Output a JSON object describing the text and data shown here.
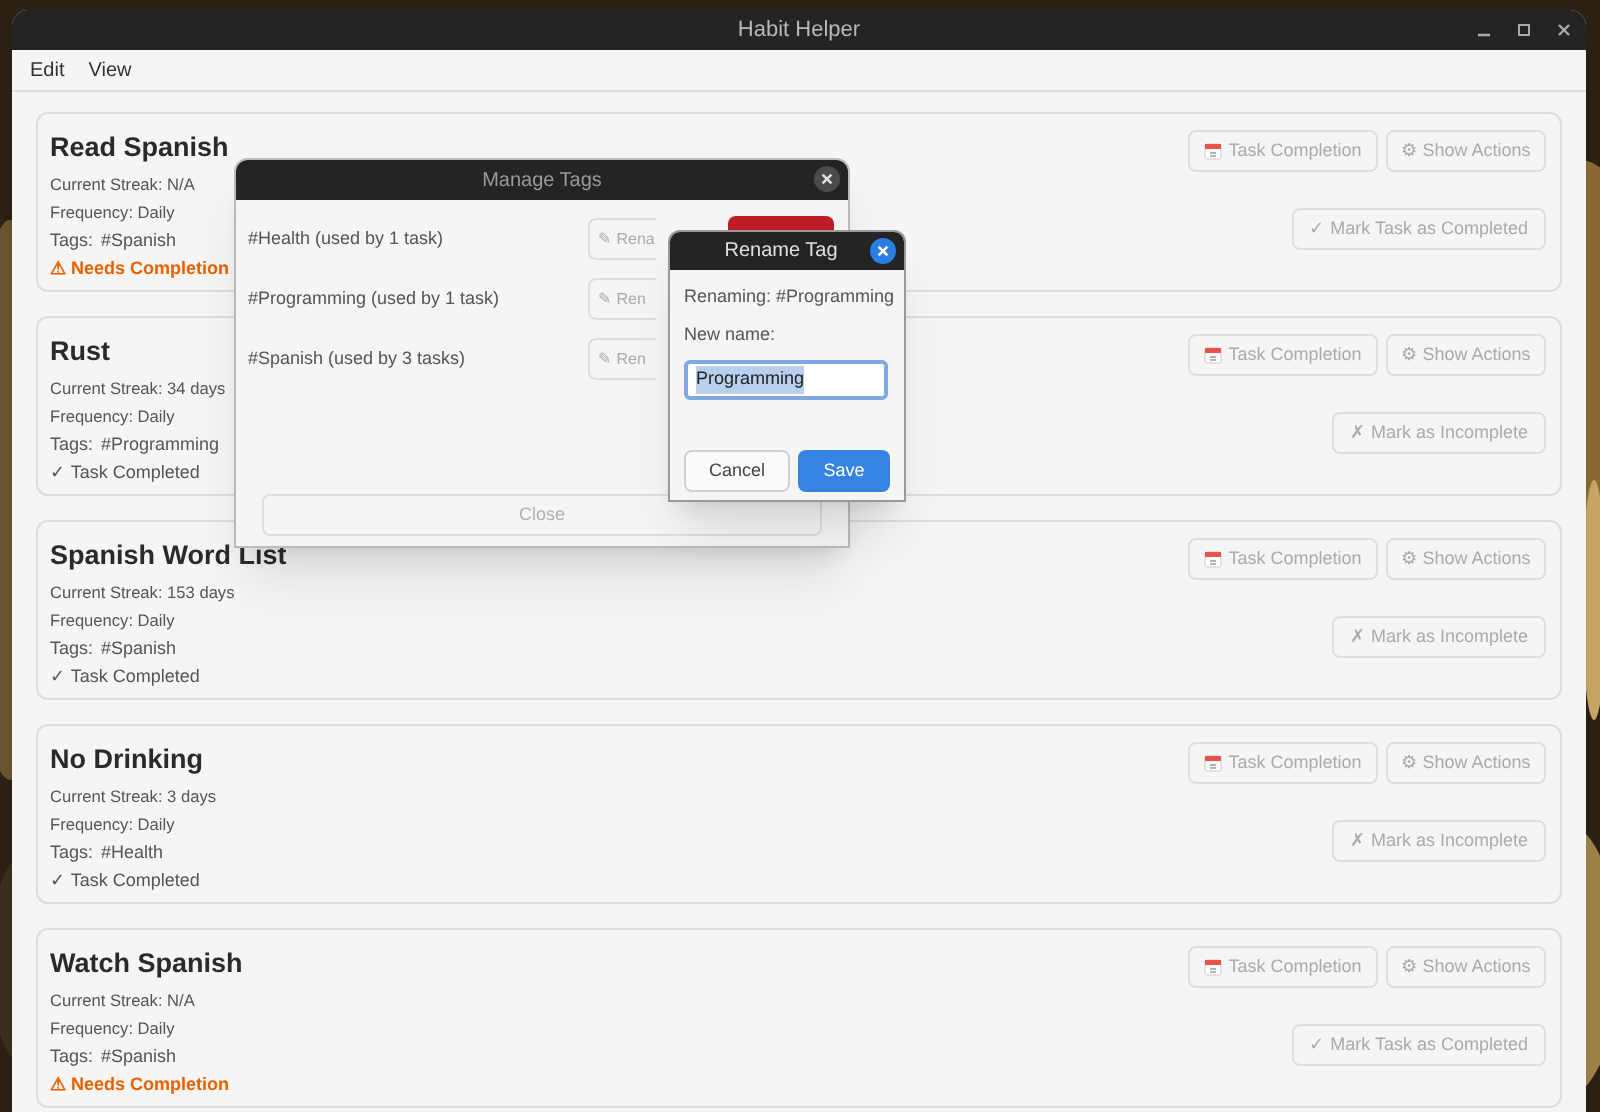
{
  "window": {
    "title": "Habit Helper"
  },
  "menu": [
    "Edit",
    "View"
  ],
  "habits": [
    {
      "title": "Read Spanish",
      "streak": "Current Streak: N/A",
      "frequency": "Frequency: Daily",
      "tags_label": "Tags:",
      "tag": "#Spanish",
      "status": {
        "kind": "pending",
        "text": "⚠ Needs Completion"
      },
      "task_completion": "Task Completion",
      "show_actions": "⚙ Show Actions",
      "mark_button": "✓ Mark Task as Completed"
    },
    {
      "title": "Rust",
      "streak": "Current Streak: 34 days",
      "frequency": "Frequency: Daily",
      "tags_label": "Tags:",
      "tag": "#Programming",
      "status": {
        "kind": "done",
        "text": "✓ Task Completed"
      },
      "task_completion": "Task Completion",
      "show_actions": "⚙ Show Actions",
      "mark_button": "✗ Mark as Incomplete"
    },
    {
      "title": "Spanish Word List",
      "streak": "Current Streak: 153 days",
      "frequency": "Frequency: Daily",
      "tags_label": "Tags:",
      "tag": "#Spanish",
      "status": {
        "kind": "done",
        "text": "✓ Task Completed"
      },
      "task_completion": "Task Completion",
      "show_actions": "⚙ Show Actions",
      "mark_button": "✗ Mark as Incomplete"
    },
    {
      "title": "No Drinking",
      "streak": "Current Streak: 3 days",
      "frequency": "Frequency: Daily",
      "tags_label": "Tags:",
      "tag": "#Health",
      "status": {
        "kind": "done",
        "text": "✓ Task Completed"
      },
      "task_completion": "Task Completion",
      "show_actions": "⚙ Show Actions",
      "mark_button": "✗ Mark as Incomplete"
    },
    {
      "title": "Watch Spanish",
      "streak": "Current Streak: N/A",
      "frequency": "Frequency: Daily",
      "tags_label": "Tags:",
      "tag": "#Spanish",
      "status": {
        "kind": "pending",
        "text": "⚠ Needs Completion"
      },
      "task_completion": "Task Completion",
      "show_actions": "⚙ Show Actions",
      "mark_button": "✓ Mark Task as Completed"
    }
  ],
  "manage_tags": {
    "title": "Manage Tags",
    "tags": [
      {
        "label": "#Health (used by 1 task)",
        "rename": "✎ Rena"
      },
      {
        "label": "#Programming (used by 1 task)",
        "rename": "✎ Ren"
      },
      {
        "label": "#Spanish (used by 3 tasks)",
        "rename": "✎ Ren"
      }
    ],
    "close": "Close"
  },
  "rename_tag": {
    "title": "Rename Tag",
    "renaming": "Renaming: #Programming",
    "new_name_label": "New name:",
    "value": "Programming",
    "cancel": "Cancel",
    "save": "Save"
  }
}
